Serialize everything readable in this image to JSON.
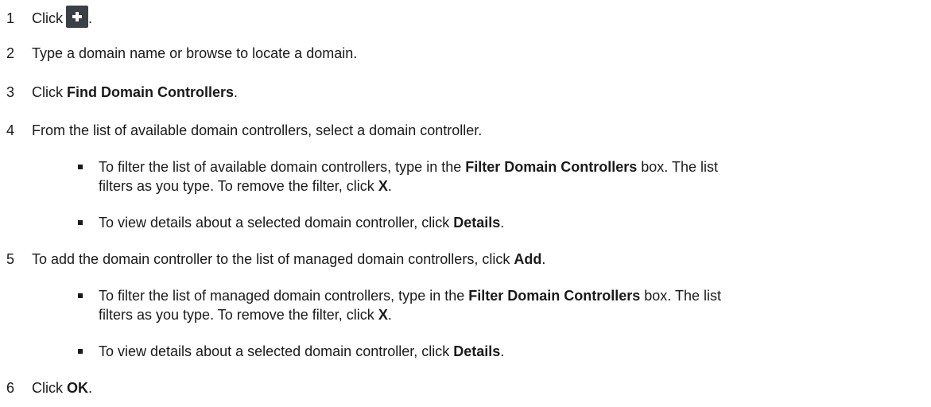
{
  "steps": [
    {
      "num": "1",
      "pre": "Click",
      "icon": "add-plus-icon",
      "post": "."
    },
    {
      "num": "2",
      "text": "Type a domain name or browse to locate a domain."
    },
    {
      "num": "3",
      "pre": "Click ",
      "bold": "Find Domain Controllers",
      "post": "."
    },
    {
      "num": "4",
      "text": "From the list of available domain controllers, select a domain controller."
    },
    {
      "num": "5",
      "pre": "To add the domain controller to the list of managed domain controllers, click ",
      "bold": "Add",
      "post": "."
    },
    {
      "num": "6",
      "pre": "Click ",
      "bold": "OK",
      "post": "."
    }
  ],
  "step4_bullets": [
    {
      "line1_pre": "To filter the list of available domain controllers, type in the ",
      "line1_bold": "Filter Domain Controllers",
      "line1_post": " box. The list",
      "line2_pre": "filters as you type. To remove the filter, click ",
      "line2_bold": "X",
      "line2_post": "."
    },
    {
      "pre": "To view details about a selected domain controller, click ",
      "bold": "Details",
      "post": "."
    }
  ],
  "step5_bullets": [
    {
      "line1_pre": "To filter the list of managed domain controllers, type in the ",
      "line1_bold": "Filter Domain Controllers",
      "line1_post": " box. The list",
      "line2_pre": "filters as you type. To remove the filter, click ",
      "line2_bold": "X",
      "line2_post": "."
    },
    {
      "pre": "To view details about a selected domain controller, click ",
      "bold": "Details",
      "post": "."
    }
  ]
}
